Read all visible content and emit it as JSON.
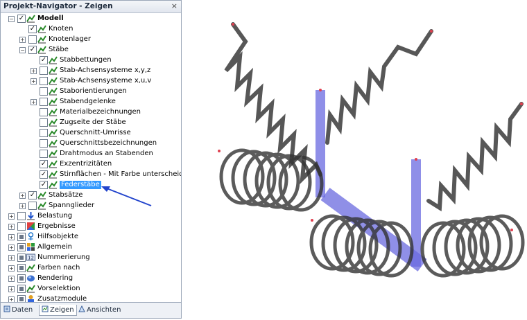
{
  "panel": {
    "title": "Projekt-Navigator - Zeigen",
    "close": "×"
  },
  "tree": [
    {
      "label": "Modell",
      "bold": true
    },
    {
      "label": "Knoten"
    },
    {
      "label": "Knotenlager"
    },
    {
      "label": "Stäbe"
    },
    {
      "label": "Stabbettungen"
    },
    {
      "label": "Stab-Achsensysteme x,y,z"
    },
    {
      "label": "Stab-Achsensysteme x,u,v"
    },
    {
      "label": "Staborientierungen"
    },
    {
      "label": "Stabendgelenke"
    },
    {
      "label": "Materialbezeichnungen"
    },
    {
      "label": "Zugseite der Stäbe"
    },
    {
      "label": "Querschnitt-Umrisse"
    },
    {
      "label": "Querschnittsbezeichnungen"
    },
    {
      "label": "Drahtmodus an Stabenden"
    },
    {
      "label": "Exzentrizitäten"
    },
    {
      "label": "Stirnflächen - Mit Farbe unterscheiden"
    },
    {
      "label": "Federstäbe",
      "selected": true
    },
    {
      "label": "Stabsätze"
    },
    {
      "label": "Spannglieder"
    },
    {
      "label": "Belastung"
    },
    {
      "label": "Ergebnisse"
    },
    {
      "label": "Hilfsobjekte"
    },
    {
      "label": "Allgemein"
    },
    {
      "label": "Nummerierung"
    },
    {
      "label": "Farben nach"
    },
    {
      "label": "Rendering"
    },
    {
      "label": "Vorselektion"
    },
    {
      "label": "Zusatzmodule"
    }
  ],
  "tabs": [
    {
      "label": "Daten"
    },
    {
      "label": "Zeigen"
    },
    {
      "label": "Ansichten"
    }
  ],
  "colors": {
    "selection": "#3399ff",
    "member": "#6a6ae0",
    "spring": "#3a3a3a",
    "arrow": "#2244cc"
  }
}
